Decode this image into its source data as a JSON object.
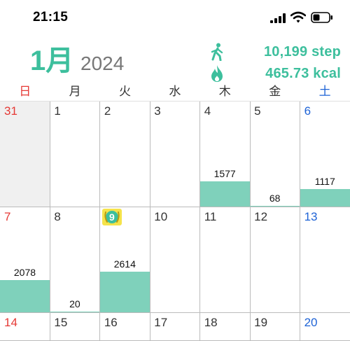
{
  "status_bar": {
    "time": "21:15"
  },
  "header": {
    "month": "1月",
    "year": "2024",
    "steps": "10,199 step",
    "kcal": "465.73 kcal"
  },
  "colors": {
    "accent": "#3dbf9d",
    "bar": "#7fd1bb",
    "sunday": "#e53935",
    "saturday": "#1e63d6"
  },
  "icons": {
    "steps": "walking-person-icon",
    "kcal": "flame-icon"
  },
  "weekdays": [
    "日",
    "月",
    "火",
    "水",
    "木",
    "金",
    "土"
  ],
  "weeks": [
    [
      {
        "day": "31",
        "other_month": true
      },
      {
        "day": "1"
      },
      {
        "day": "2"
      },
      {
        "day": "3"
      },
      {
        "day": "4",
        "steps": "1577",
        "level": 0.24
      },
      {
        "day": "5",
        "steps": "68",
        "level": 0.01
      },
      {
        "day": "6",
        "steps": "1117",
        "level": 0.17
      }
    ],
    [
      {
        "day": "7",
        "steps": "2078",
        "level": 0.31
      },
      {
        "day": "8",
        "steps": "20",
        "level": 0.0
      },
      {
        "day": "9",
        "today": true,
        "steps": "2614",
        "level": 0.39
      },
      {
        "day": "10"
      },
      {
        "day": "11"
      },
      {
        "day": "12"
      },
      {
        "day": "13"
      }
    ],
    [
      {
        "day": "14"
      },
      {
        "day": "15"
      },
      {
        "day": "16"
      },
      {
        "day": "17"
      },
      {
        "day": "18"
      },
      {
        "day": "19"
      },
      {
        "day": "20"
      }
    ]
  ]
}
